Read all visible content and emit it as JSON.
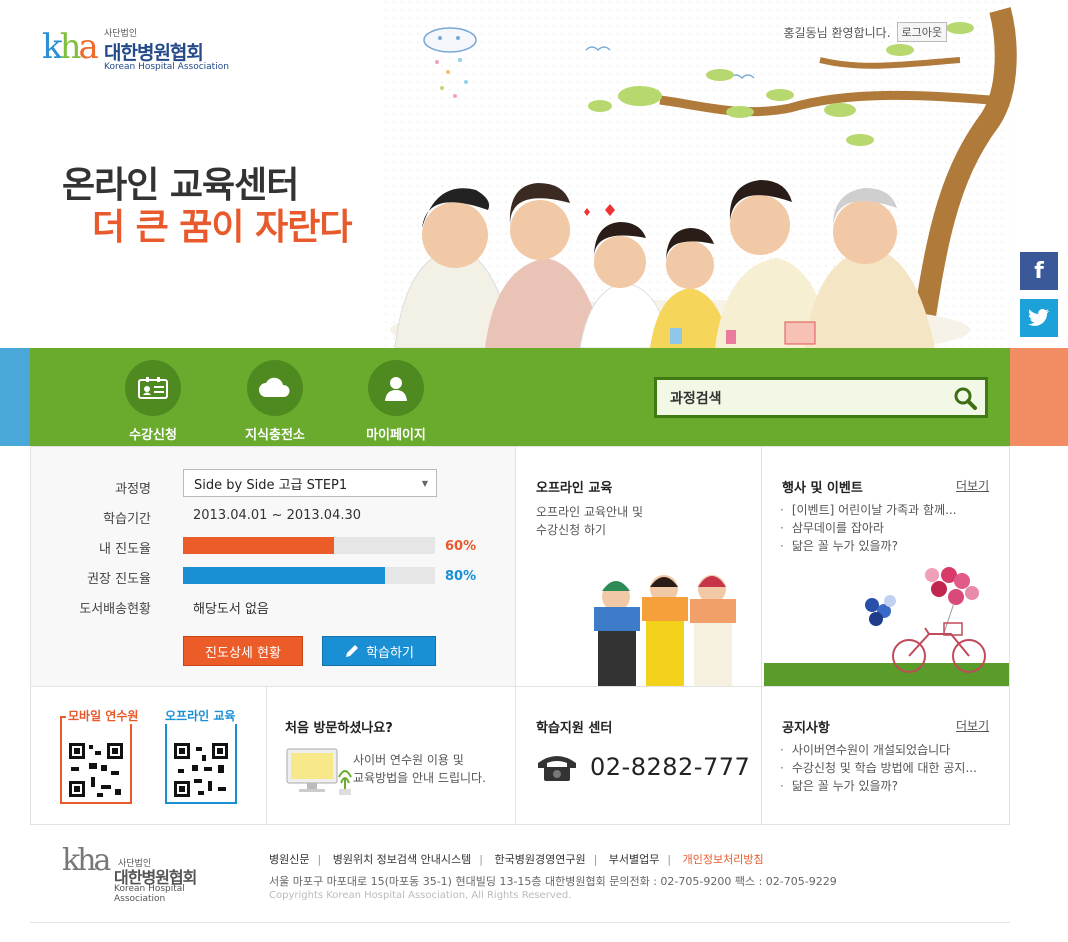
{
  "header": {
    "logo_sub": "사단법인",
    "logo_name": "대한병원협회",
    "logo_en": "Korean Hospital Association",
    "logo_tiny": "Korean Hospital Association",
    "welcome_text": "홍길동님 환영합니다.",
    "logout_label": "로그아웃"
  },
  "hero": {
    "title_line1": "온라인 교육센터",
    "title_line2": "더 큰 꿈이 자란다"
  },
  "sns": {
    "facebook": "f",
    "twitter": "t"
  },
  "nav": {
    "items": [
      {
        "label": "수강신청",
        "icon": "id-card-icon"
      },
      {
        "label": "지식충전소",
        "icon": "cloud-icon"
      },
      {
        "label": "마이페이지",
        "icon": "person-icon"
      }
    ],
    "search_label": "과정검색"
  },
  "progress": {
    "course_label": "과정명",
    "course_value": "Side by Side 고급 STEP1",
    "period_label": "학습기간",
    "period_value": "2013.04.01 ~ 2013.04.30",
    "my_progress_label": "내 진도율",
    "my_progress_value": 60,
    "my_progress_text": "60%",
    "recommended_label": "권장 진도율",
    "recommended_value": 80,
    "recommended_text": "80%",
    "delivery_label": "도서배송현황",
    "delivery_value": "해당도서 없음",
    "detail_button": "진도상세 현황",
    "study_button": "학습하기"
  },
  "offline": {
    "title": "오프라인 교육",
    "desc_line1": "오프라인 교육안내 및",
    "desc_line2": "수강신청 하기"
  },
  "events": {
    "title": "행사 및 이벤트",
    "more": "더보기",
    "items": [
      "[이벤트] 어린이날 가족과 함께...",
      "삼무데이를 잡아라",
      "닮은 꼴 누가 있을까?"
    ]
  },
  "qr": {
    "mobile_label": "모바일 연수원",
    "offline_label": "오프라인 교육"
  },
  "first_visit": {
    "title": "처음 방문하셨나요?",
    "desc_line1": "사이버 연수원 이용 및",
    "desc_line2": "교육방법을 안내 드립니다."
  },
  "support": {
    "title": "학습지원 센터",
    "phone": "02-8282-777"
  },
  "notice": {
    "title": "공지사항",
    "more": "더보기",
    "items": [
      "사이버연수원이 개설되었습니다",
      "수강신청 및 학습 방법에 대한 공지...",
      "닮은 꼴 누가 있을까?"
    ]
  },
  "footer": {
    "links": [
      "병원신문",
      "병원위치 정보검색 안내시스템",
      "한국병원경영연구원",
      "부서별업무",
      "개인정보처리방침"
    ],
    "address": "서울 마포구 마포대로 15(마포동 35-1) 현대빌딩 13-15층 대한병원협회 문의전화 : 02-705-9200  팩스 : 02-705-9229",
    "copyright": "Copyrights Korean Hospital Association, All Rights Reserved."
  },
  "colors": {
    "green": "#6aab2e",
    "orange": "#e8592b",
    "blue": "#1a8fd4"
  }
}
